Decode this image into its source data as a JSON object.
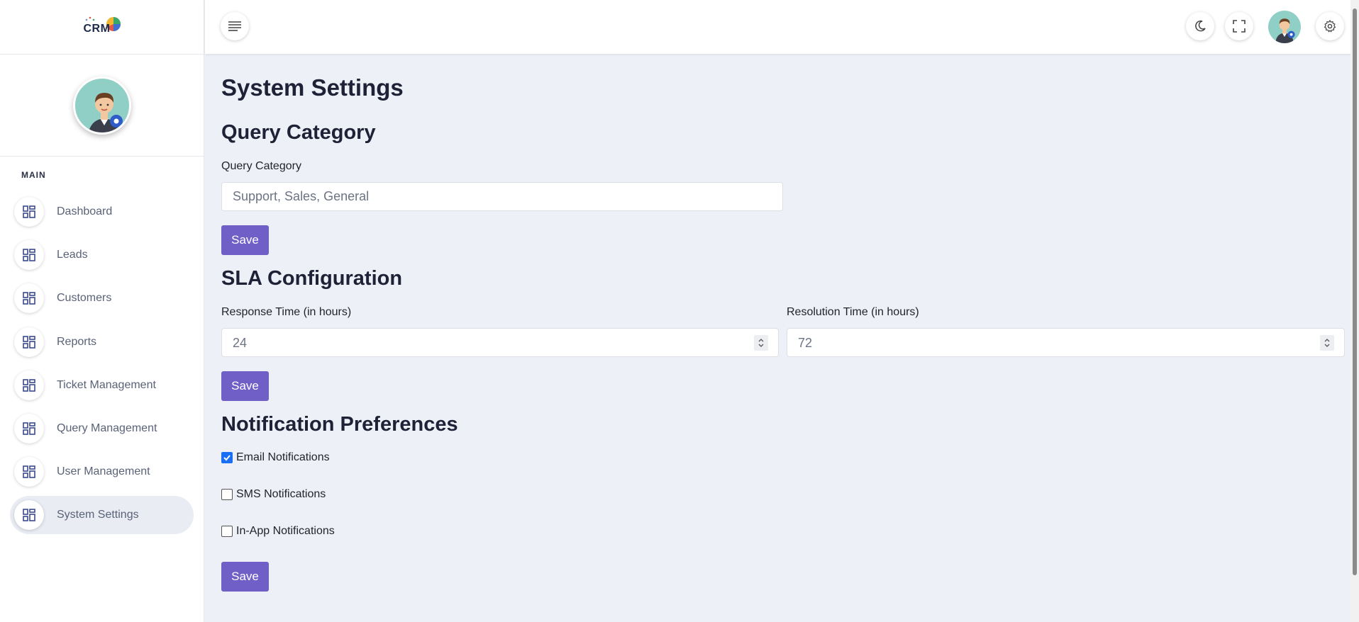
{
  "app": {
    "logo_text": "CRM"
  },
  "sidebar": {
    "section_label": "MAIN",
    "items": [
      {
        "label": "Dashboard",
        "icon": "dashboard-grid-icon",
        "active": false
      },
      {
        "label": "Leads",
        "icon": "dashboard-grid-icon",
        "active": false
      },
      {
        "label": "Customers",
        "icon": "dashboard-grid-icon",
        "active": false
      },
      {
        "label": "Reports",
        "icon": "dashboard-grid-icon",
        "active": false
      },
      {
        "label": "Ticket Management",
        "icon": "dashboard-grid-icon",
        "active": false
      },
      {
        "label": "Query Management",
        "icon": "dashboard-grid-icon",
        "active": false
      },
      {
        "label": "User Management",
        "icon": "dashboard-grid-icon",
        "active": false
      },
      {
        "label": "System Settings",
        "icon": "dashboard-grid-icon",
        "active": true
      }
    ]
  },
  "header": {
    "menu_icon": "hamburger-menu-icon",
    "theme_icon": "moon-icon",
    "fullscreen_icon": "fullscreen-icon",
    "settings_icon": "gear-icon"
  },
  "main": {
    "page_title": "System Settings",
    "query_category": {
      "title": "Query Category",
      "field_label": "Query Category",
      "placeholder": "Support, Sales, General",
      "save_label": "Save"
    },
    "sla": {
      "title": "SLA Configuration",
      "response_label": "Response Time (in hours)",
      "response_value": "24",
      "resolution_label": "Resolution Time (in hours)",
      "resolution_value": "72",
      "save_label": "Save"
    },
    "notifications": {
      "title": "Notification Preferences",
      "email_label": "Email Notifications",
      "email_checked": true,
      "sms_label": "SMS Notifications",
      "sms_checked": false,
      "inapp_label": "In-App Notifications",
      "inapp_checked": false,
      "save_label": "Save"
    }
  },
  "colors": {
    "primary_button": "#6f5fc7",
    "checkbox_checked": "#1a6ff5",
    "page_background": "#eef0f7",
    "avatar_background": "#8fcfc6"
  }
}
